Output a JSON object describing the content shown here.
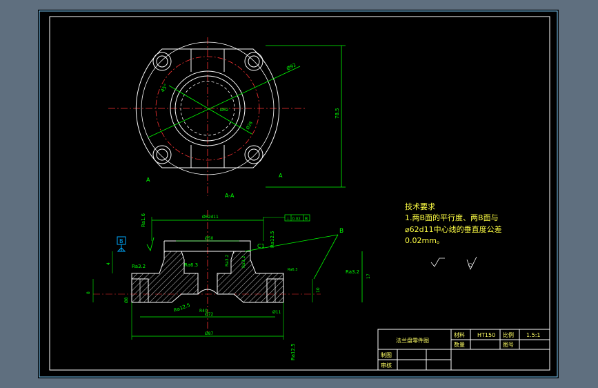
{
  "colors": {
    "background": "#5f6f7f",
    "sheet": "#000000",
    "frame_outer": "#7fd0ff",
    "frame_inner": "#ffffff",
    "outline": "#ffffff",
    "dimension": "#00ff00",
    "centerline": "#ff3333",
    "note_text": "#ffff44",
    "title_text": "#ffff66"
  },
  "top_view": {
    "section_label": "A-A",
    "cut_label_left": "A",
    "cut_label_right": "A",
    "dim_pcd": "Ø92",
    "dim_height": "78.5",
    "dim_bore": "Ø28",
    "dim_angle": "45°",
    "dim_small": "R4",
    "center_text": "Ø62"
  },
  "section_view": {
    "dim_top_width": "Ø62d11",
    "dim_inner": "Ø50",
    "dim_bottom_inner": "Ø72",
    "dim_bottom_outer": "Ø87",
    "dim_height": "17",
    "dim_right_mid": "10",
    "dim_left_small": "8",
    "dim_step": "4",
    "dim_r": "R40",
    "dim_hole": "Ø8",
    "dim_slot": "Ø11",
    "chamfer": "C1",
    "ra_top": "Ra1.6",
    "ra_left": "Ra3.2",
    "ra_inner": "Ra6.3",
    "ra_inner2": "Ra3.2",
    "ra_right": "Ra3.2",
    "ra_bottom_left": "Ra12.5",
    "ra_bottom_right": "Ra12.5",
    "ra_right_top": "Ra12.5",
    "ra_side": "Ra3.2",
    "ra_small": "Ra6.3",
    "datum_label": "B",
    "face_label": "B",
    "tolerance_frame": [
      "⊥",
      "0.02",
      "B"
    ]
  },
  "notes": {
    "heading": "技术要求",
    "line1": "1.两B面的平行度、两B面与",
    "line2": "⌀62d11中心线的垂直度公差",
    "line3": "0.02mm。"
  },
  "title_block": {
    "part_name": "法兰盘零件图",
    "material_label": "材料",
    "material_value": "HT150",
    "scale_label": "比例",
    "scale_value": "1.5:1",
    "quantity_label": "数量",
    "drawing_no_label": "图号",
    "drawn_label": "制图",
    "checked_label": "审核"
  }
}
